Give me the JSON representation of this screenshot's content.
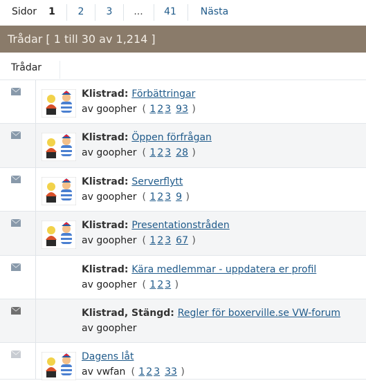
{
  "pagination": {
    "label": "Sidor",
    "current": "1",
    "pages": [
      "2",
      "3"
    ],
    "ellipsis": "...",
    "last": "41",
    "next": "Nästa"
  },
  "header": {
    "title": "Trådar [ 1 till 30 av 1,214 ]"
  },
  "columns": {
    "threads": "Trådar"
  },
  "threads": [
    {
      "prefix": "Klistrad",
      "title": "Förbättringar",
      "by": "av goopher",
      "pages": [
        "1",
        "2",
        "3"
      ],
      "last_page": "93",
      "status": "normal",
      "has_avatar": true
    },
    {
      "prefix": "Klistrad",
      "title": "Öppen förfrågan",
      "by": "av goopher",
      "pages": [
        "1",
        "2",
        "3"
      ],
      "last_page": "28",
      "status": "normal",
      "has_avatar": true
    },
    {
      "prefix": "Klistrad",
      "title": "Serverflytt",
      "by": "av goopher",
      "pages": [
        "1",
        "2",
        "3"
      ],
      "last_page": "9",
      "status": "normal",
      "has_avatar": true
    },
    {
      "prefix": "Klistrad",
      "title": "Presentationstråden",
      "by": "av goopher",
      "pages": [
        "1",
        "2",
        "3"
      ],
      "last_page": "67",
      "status": "normal",
      "has_avatar": true
    },
    {
      "prefix": "Klistrad",
      "title": "Kära medlemmar - uppdatera er profil",
      "by": "av goopher",
      "pages": [
        "1",
        "2",
        "3"
      ],
      "last_page": "",
      "status": "normal",
      "has_avatar": false
    },
    {
      "prefix": "Klistrad, Stängd",
      "title": "Regler för boxerville.se VW-forum",
      "by": "av goopher",
      "pages": [],
      "last_page": "",
      "status": "locked",
      "has_avatar": false
    },
    {
      "prefix": "",
      "title": "Dagens låt",
      "by": "av vwfan",
      "pages": [
        "1",
        "2",
        "3"
      ],
      "last_page": "33",
      "status": "read",
      "has_avatar": true
    }
  ],
  "colors": {
    "header_bg": "#8a7b6a",
    "link": "#1f5a8a",
    "icon_normal": "#8899aa",
    "icon_locked": "#707070",
    "icon_read": "#c8ccd2"
  }
}
